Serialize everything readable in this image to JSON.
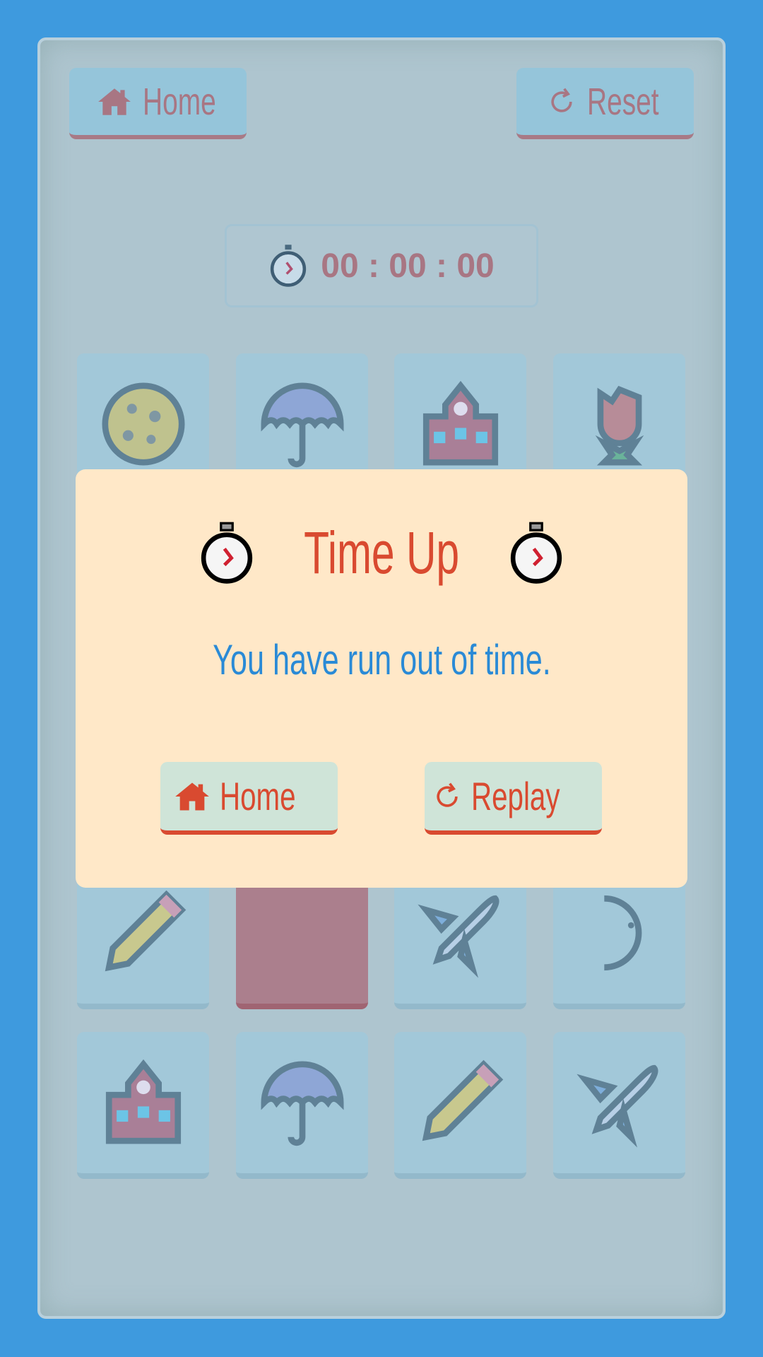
{
  "header": {
    "home_label": "Home",
    "reset_label": "Reset"
  },
  "timer": {
    "value": "00 : 00 : 00",
    "icon": "stopwatch-icon"
  },
  "board": {
    "cards": [
      [
        "cookie",
        "umbrella",
        "school",
        "rose"
      ],
      [
        "hidden",
        "hidden",
        "hidden",
        "face-down"
      ],
      [
        "hidden",
        "hidden",
        "hidden",
        "hidden"
      ],
      [
        "pencil",
        "face-down",
        "airplane",
        "moon"
      ],
      [
        "school",
        "umbrella",
        "pencil",
        "airplane"
      ]
    ]
  },
  "modal": {
    "title": "Time Up",
    "message": "You have run out of time.",
    "home_label": "Home",
    "replay_label": "Replay"
  },
  "colors": {
    "background": "#3e9ade",
    "accent_red": "#d94a30",
    "text_blue": "#2a8ad6",
    "modal_bg": "#ffe8c8"
  }
}
